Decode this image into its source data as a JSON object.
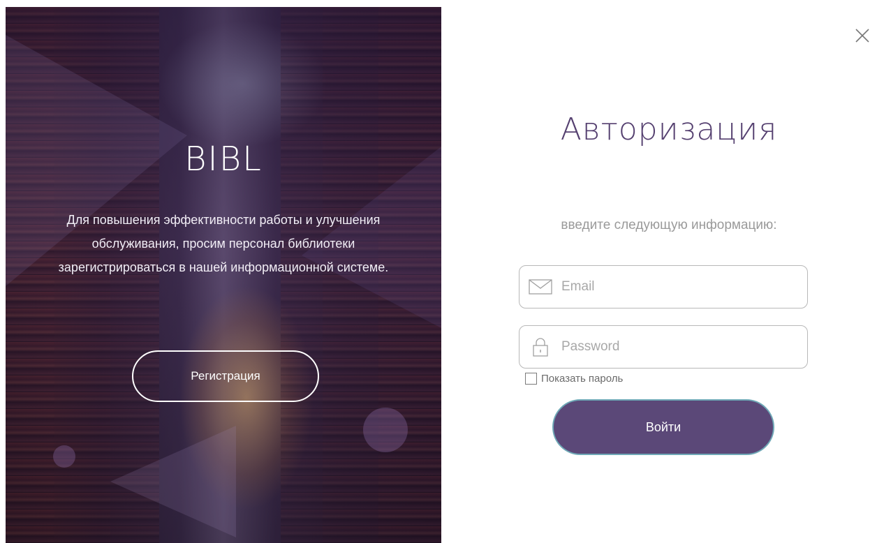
{
  "hero": {
    "brand": "BIBL",
    "description": "Для повышения эффективности работы и улучшения обслуживания, просим персонал библиотеки зарегистрироваться в нашей информационной системе.",
    "register_label": "Регистрация"
  },
  "auth": {
    "title": "Авторизация",
    "subtitle": "введите следующую информацию:",
    "email_placeholder": "Email",
    "email_icon": "envelope-icon",
    "password_placeholder": "Password",
    "password_icon": "lock-icon",
    "show_password_label": "Показать пароль",
    "show_password_checked": false,
    "login_label": "Войти",
    "close_icon": "close-icon"
  },
  "colors": {
    "accent": "#5b4878",
    "title": "#554070",
    "button_border": "#6fa8b6"
  }
}
